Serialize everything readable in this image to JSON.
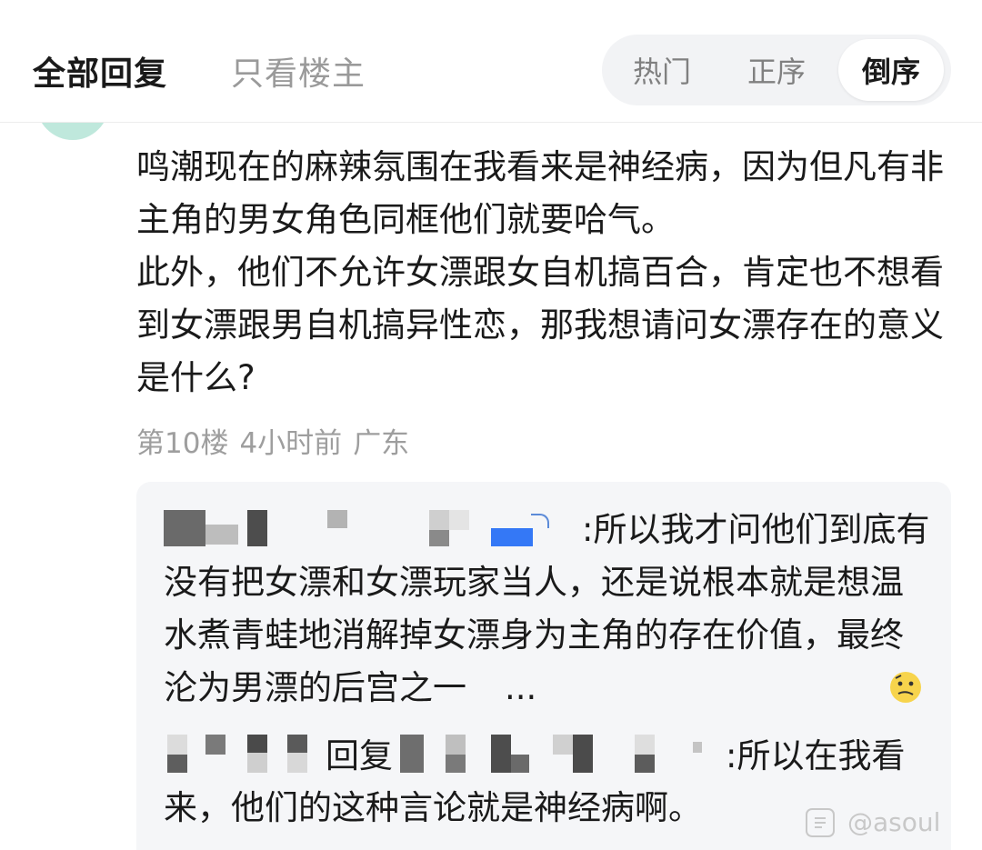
{
  "header": {
    "tab_all": "全部回复",
    "tab_op_only": "只看楼主",
    "sort": {
      "hot": "热门",
      "asc": "正序",
      "desc": "倒序",
      "selected": "倒序"
    }
  },
  "comment": {
    "paragraphs": [
      "鸣潮现在的麻辣氛围在我看来是神经病，因为但凡有非主角的男女角色同框他们就要哈气。",
      "此外，他们不允许女漂跟女自机搞百合，肯定也不想看到女漂跟男自机搞异性恋，那我想请问女漂存在的意义是什么?"
    ],
    "floor": "第10楼",
    "time": "4小时前",
    "location": "广东"
  },
  "replies": [
    {
      "text": ":所以我才问他们到底有没有把女漂和女漂玩家当人，还是说根本就是想温水煮青蛙地消解掉女漂身为主角的存在价值，最终沦为男漂的后宫之一",
      "ellipsis": "..."
    },
    {
      "label": "回复",
      "text_line1": ":所以在我看",
      "text_line2": "来，他们的这种言论就是神经病啊。"
    }
  ],
  "watermark": {
    "text": "@asoul",
    "icon": "app-logo-icon"
  },
  "colors": {
    "accent_blue": "#3478f6",
    "mosaic_dark": "#5a5a5a",
    "mosaic_light": "#c9c9c9",
    "meta_gray": "#9e9e9e"
  }
}
